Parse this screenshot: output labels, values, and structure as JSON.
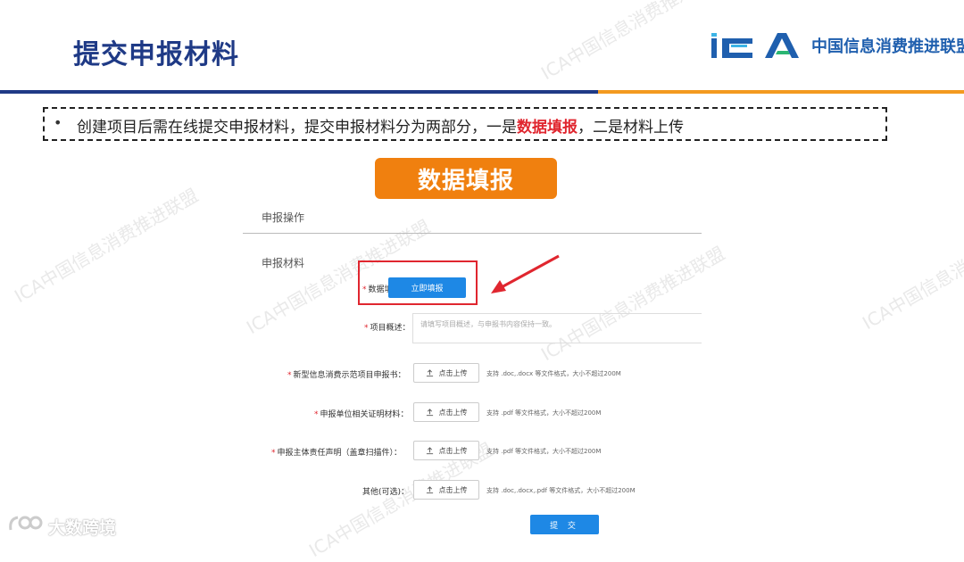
{
  "slide": {
    "title": "提交申报材料",
    "logo_text": "中国信息消费推进联盟",
    "logo_mark": "ICA",
    "intro_bullet": "•",
    "intro_text_before": "创建项目后需在线提交申报材料，提交申报材料分为两部分，一是",
    "intro_highlight": "数据填报",
    "intro_text_after": "，二是材料上传",
    "badge_label": "数据填报",
    "bottom_logo_text": "大数跨境"
  },
  "form": {
    "section_title": "申报操作",
    "group_label": "申报材料",
    "required_mark": "*",
    "fields": {
      "data_fill_label": "数据填报：",
      "data_fill_button": "立即填报",
      "overview_label": "项目概述：",
      "overview_placeholder": "请填写项目概述，与申报书内容保持一致。",
      "upload_button": "点击上传",
      "file1_label": "新型信息消费示范项目申报书：",
      "file1_hint": "支持 .doc,.docx 等文件格式，大小不超过200M",
      "file2_label": "申报单位相关证明材料：",
      "file2_hint": "支持 .pdf 等文件格式，大小不超过200M",
      "file3_label": "申报主体责任声明（盖章扫描件）：",
      "file3_hint": "支持 .pdf 等文件格式，大小不超过200M",
      "file4_label": "其他(可选)：",
      "file4_hint": "支持 .doc,.docx,.pdf 等文件格式，大小不超过200M"
    },
    "submit_button": "提 交"
  },
  "watermark_text": "ICA中国信息消费推进联盟",
  "colors": {
    "title": "#1f3a86",
    "accent_orange": "#f0800f",
    "highlight_red": "#e0262f",
    "primary_blue": "#1e88e5"
  }
}
